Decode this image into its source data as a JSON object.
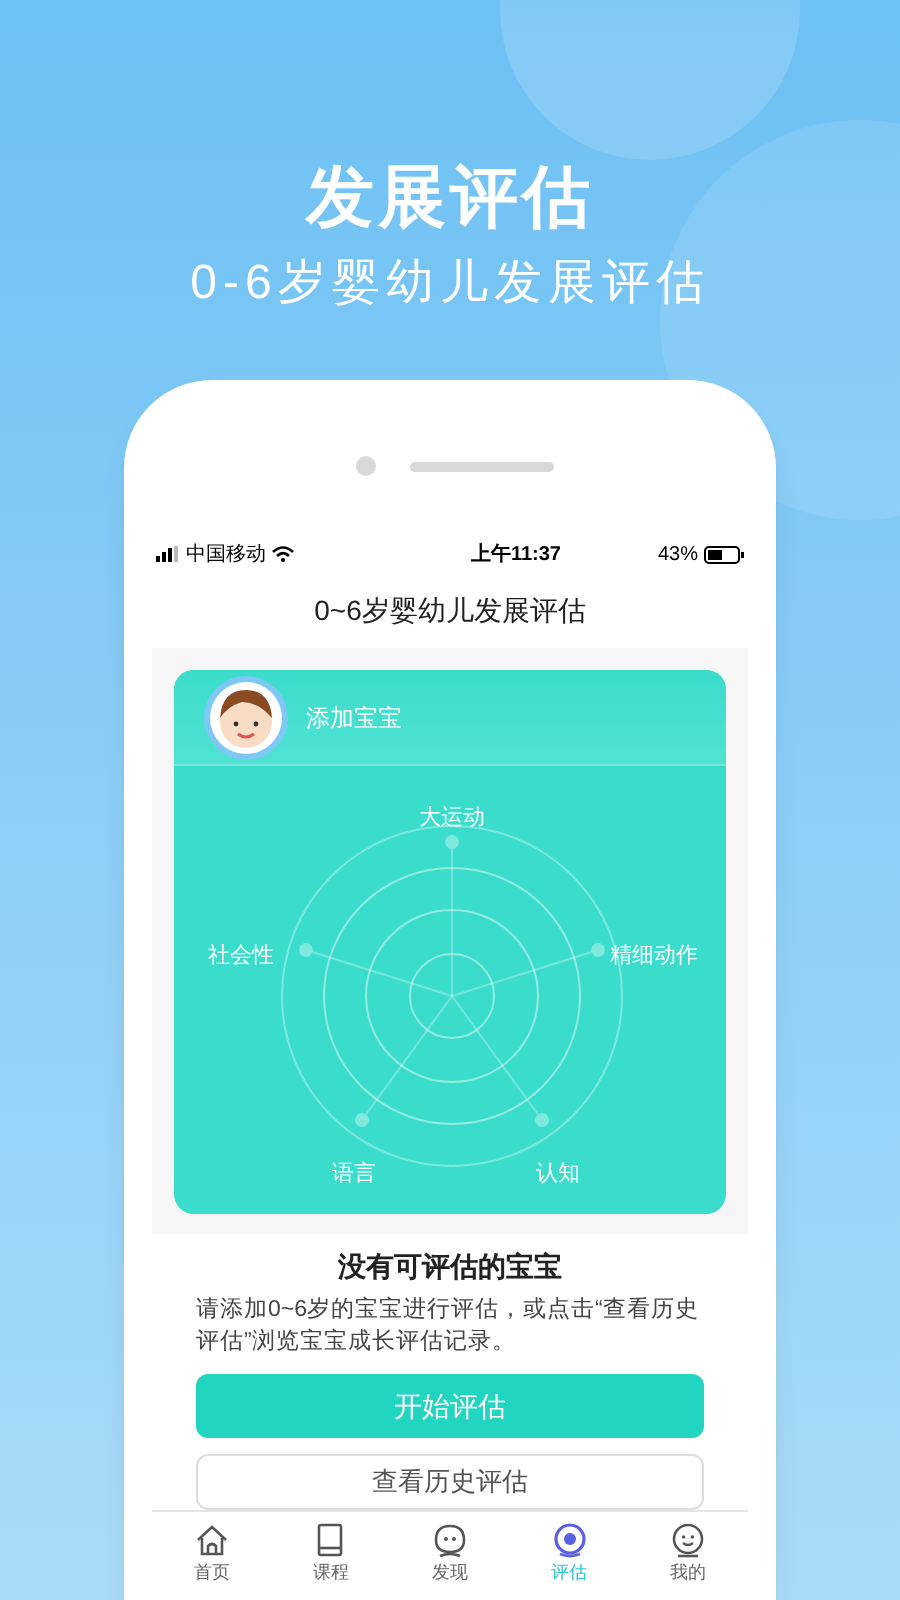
{
  "promo": {
    "title": "发展评估",
    "subtitle": "0-6岁婴幼儿发展评估"
  },
  "status_bar": {
    "carrier": "中国移动",
    "time": "上午11:37",
    "battery": "43%"
  },
  "nav": {
    "title": "0~6岁婴幼儿发展评估"
  },
  "card": {
    "add_baby": "添加宝宝",
    "radar_labels": [
      "大运动",
      "精细动作",
      "认知",
      "语言",
      "社会性"
    ]
  },
  "empty": {
    "title": "没有可评估的宝宝",
    "message": "请添加0~6岁的宝宝进行评估，或点击“查看历史评估”浏览宝宝成长评估记录。"
  },
  "buttons": [
    {
      "label": "开始评估",
      "kind": "primary"
    },
    {
      "label": "查看历史评估",
      "kind": "outline"
    }
  ],
  "tabs": [
    {
      "label": "首页",
      "selected": false
    },
    {
      "label": "课程",
      "selected": false
    },
    {
      "label": "发现",
      "selected": false
    },
    {
      "label": "评估",
      "selected": true
    },
    {
      "label": "我的",
      "selected": false
    }
  ]
}
